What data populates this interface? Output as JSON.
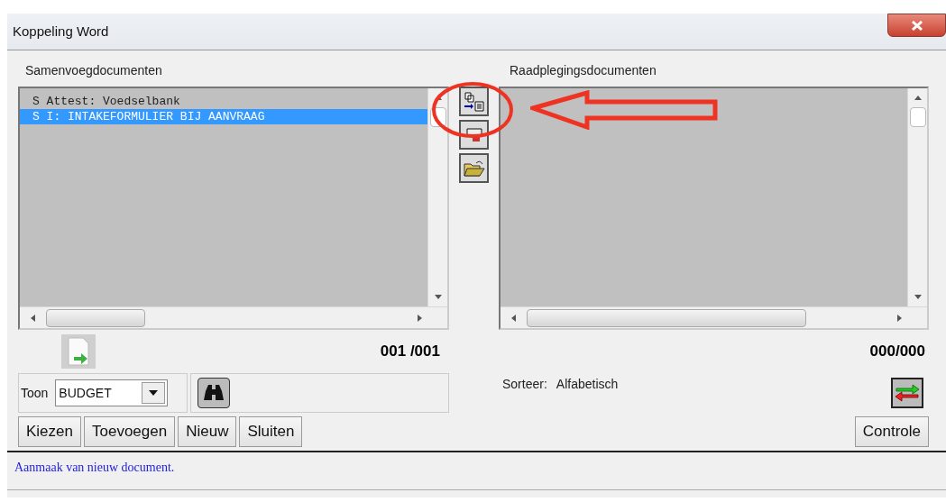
{
  "window": {
    "title": "Koppeling Word"
  },
  "left_panel": {
    "title": "Samenvoegdocumenten",
    "items": [
      {
        "text": "S Attest: Voedselbank",
        "selected": false
      },
      {
        "text": "S I: INTAKEFORMULIER BIJ AANVRAAG",
        "selected": true
      }
    ],
    "counter": "001 /001"
  },
  "right_panel": {
    "title": "Raadplegingsdocumenten",
    "counter": "000/000"
  },
  "filter": {
    "label": "Toon",
    "value": "BUDGET"
  },
  "sort": {
    "label": "Sorteer:",
    "value": "Alfabetisch"
  },
  "buttons": [
    "Kiezen",
    "Toevoegen",
    "Nieuw",
    "Sluiten"
  ],
  "check_button": "Controle",
  "status": "Aanmaak van nieuw document."
}
